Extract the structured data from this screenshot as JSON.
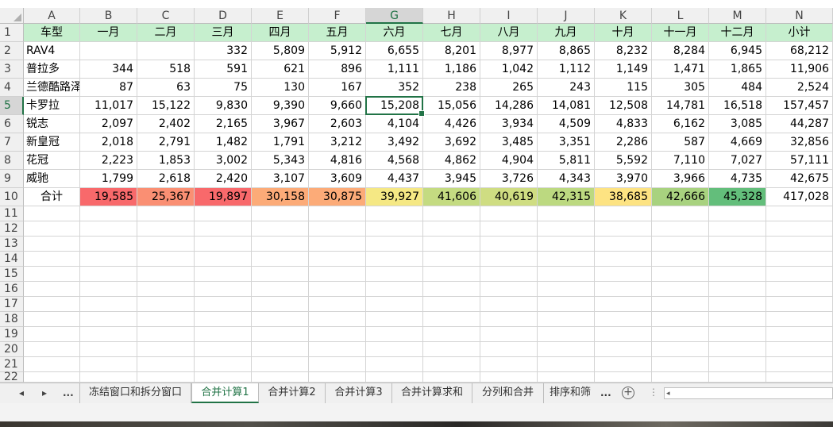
{
  "columns": [
    "A",
    "B",
    "C",
    "D",
    "E",
    "F",
    "G",
    "H",
    "I",
    "J",
    "K",
    "L",
    "M",
    "N"
  ],
  "active_column": "G",
  "active_row": 5,
  "row_numbers": [
    "1",
    "2",
    "3",
    "4",
    "5",
    "6",
    "7",
    "8",
    "9",
    "10",
    "11",
    "12",
    "13",
    "14",
    "15",
    "16",
    "17",
    "18",
    "19",
    "20",
    "21",
    "22"
  ],
  "header_row": [
    "车型",
    "一月",
    "二月",
    "三月",
    "四月",
    "五月",
    "六月",
    "七月",
    "八月",
    "九月",
    "十月",
    "十一月",
    "十二月",
    "小计"
  ],
  "header_fill": "#c6efce",
  "data_rows": [
    [
      "RAV4",
      "",
      "",
      "332",
      "5,809",
      "5,912",
      "6,655",
      "8,201",
      "8,977",
      "8,865",
      "8,232",
      "8,284",
      "6,945",
      "68,212"
    ],
    [
      "普拉多",
      "344",
      "518",
      "591",
      "621",
      "896",
      "1,111",
      "1,186",
      "1,042",
      "1,112",
      "1,149",
      "1,471",
      "1,865",
      "11,906"
    ],
    [
      "兰德酷路泽",
      "87",
      "63",
      "75",
      "130",
      "167",
      "352",
      "238",
      "265",
      "243",
      "115",
      "305",
      "484",
      "2,524"
    ],
    [
      "卡罗拉",
      "11,017",
      "15,122",
      "9,830",
      "9,390",
      "9,660",
      "15,208",
      "15,056",
      "14,286",
      "14,081",
      "12,508",
      "14,781",
      "16,518",
      "157,457"
    ],
    [
      "锐志",
      "2,097",
      "2,402",
      "2,165",
      "3,967",
      "2,603",
      "4,104",
      "4,426",
      "3,934",
      "4,509",
      "4,833",
      "6,162",
      "3,085",
      "44,287"
    ],
    [
      "新皇冠",
      "2,018",
      "2,791",
      "1,482",
      "1,791",
      "3,212",
      "3,492",
      "3,692",
      "3,485",
      "3,351",
      "2,286",
      "587",
      "4,669",
      "32,856"
    ],
    [
      "花冠",
      "2,223",
      "1,853",
      "3,002",
      "5,343",
      "4,816",
      "4,568",
      "4,862",
      "4,904",
      "5,811",
      "5,592",
      "7,110",
      "7,027",
      "57,111"
    ],
    [
      "威驰",
      "1,799",
      "2,618",
      "2,420",
      "3,107",
      "3,609",
      "4,437",
      "3,945",
      "3,726",
      "4,343",
      "3,970",
      "3,966",
      "4,735",
      "42,675"
    ]
  ],
  "total_row": {
    "label": "合计",
    "values": [
      "19,585",
      "25,367",
      "19,897",
      "30,158",
      "30,875",
      "39,927",
      "41,606",
      "40,619",
      "42,315",
      "38,685",
      "42,666",
      "45,328",
      "417,028"
    ],
    "fills": [
      "#f8696b",
      "#fa8f73",
      "#f8696b",
      "#fcab78",
      "#fcab78",
      "#f5e884",
      "#c4db81",
      "#cfdd82",
      "#bcd980",
      "#fde382",
      "#a8d27f",
      "#63be7b",
      "#ffffff"
    ]
  },
  "tabbar": {
    "nav_prev": "◂",
    "nav_next": "▸",
    "nav_more": "...",
    "tabs": [
      "冻结窗口和拆分窗口",
      "合并计算1",
      "合并计算2",
      "合并计算3",
      "合并计算求和",
      "分列和合并",
      "排序和筛"
    ],
    "active_tab": 1,
    "overflow": "...",
    "add_sheet": "+",
    "separator": "⋮",
    "scroll_arrow": "◂"
  }
}
